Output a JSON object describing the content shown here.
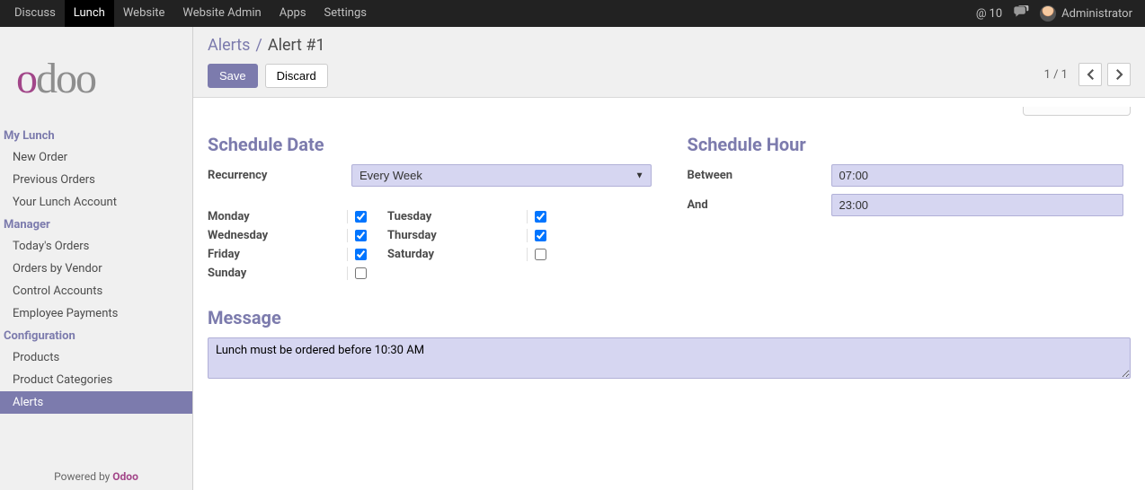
{
  "topnav": {
    "items": [
      "Discuss",
      "Lunch",
      "Website",
      "Website Admin",
      "Apps",
      "Settings"
    ],
    "active_index": 1,
    "notif_count": "10",
    "user": "Administrator"
  },
  "sidebar": {
    "sections": [
      {
        "title": "My Lunch",
        "items": [
          "New Order",
          "Previous Orders",
          "Your Lunch Account"
        ]
      },
      {
        "title": "Manager",
        "items": [
          "Today's Orders",
          "Orders by Vendor",
          "Control Accounts",
          "Employee Payments"
        ]
      },
      {
        "title": "Configuration",
        "items": [
          "Products",
          "Product Categories",
          "Alerts"
        ]
      }
    ],
    "active": "Alerts",
    "powered_by": "Powered by ",
    "odoo": "Odoo"
  },
  "breadcrumb": {
    "parent": "Alerts",
    "current": "Alert #1"
  },
  "buttons": {
    "save": "Save",
    "discard": "Discard"
  },
  "pager": "1 / 1",
  "schedule_date": {
    "title": "Schedule Date",
    "recurrency_label": "Recurrency",
    "recurrency_value": "Every Week",
    "days": {
      "monday": "Monday",
      "tuesday": "Tuesday",
      "wednesday": "Wednesday",
      "thursday": "Thursday",
      "friday": "Friday",
      "saturday": "Saturday",
      "sunday": "Sunday"
    },
    "checked": {
      "monday": true,
      "tuesday": true,
      "wednesday": true,
      "thursday": true,
      "friday": true,
      "saturday": false,
      "sunday": false
    }
  },
  "schedule_hour": {
    "title": "Schedule Hour",
    "between_label": "Between",
    "and_label": "And",
    "between_value": "07:00",
    "and_value": "23:00"
  },
  "message": {
    "title": "Message",
    "value": "Lunch must be ordered before 10:30 AM"
  }
}
